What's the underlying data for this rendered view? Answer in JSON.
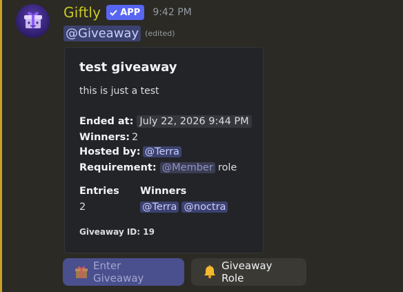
{
  "accent": "#c9a227",
  "author": {
    "name": "Giftly",
    "badge": "APP",
    "timestamp": "9:42 PM",
    "avatar_icon": "gift-bot-icon"
  },
  "message": {
    "mention": "@Giveaway",
    "edited": "(edited)"
  },
  "embed": {
    "title": "test giveaway",
    "description": "this is just a test",
    "ended_label": "Ended at:",
    "ended_value": "July 22, 2026 9:44 PM",
    "winners_label": "Winners:",
    "winners_value": "2",
    "hosted_label": "Hosted by:",
    "hosted_value": "@Terra",
    "requirement_label": "Requirement:",
    "requirement_role": "@Member",
    "requirement_suffix": "role",
    "entries_header": "Entries",
    "entries_value": "2",
    "winners_header": "Winners",
    "winners_list": [
      "@Terra",
      "@noctra"
    ],
    "footer": "Giveaway ID: 19"
  },
  "buttons": {
    "enter": {
      "label": "Enter Giveaway",
      "icon": "gift-icon"
    },
    "role": {
      "label": "Giveaway Role",
      "icon": "bell-icon"
    }
  }
}
